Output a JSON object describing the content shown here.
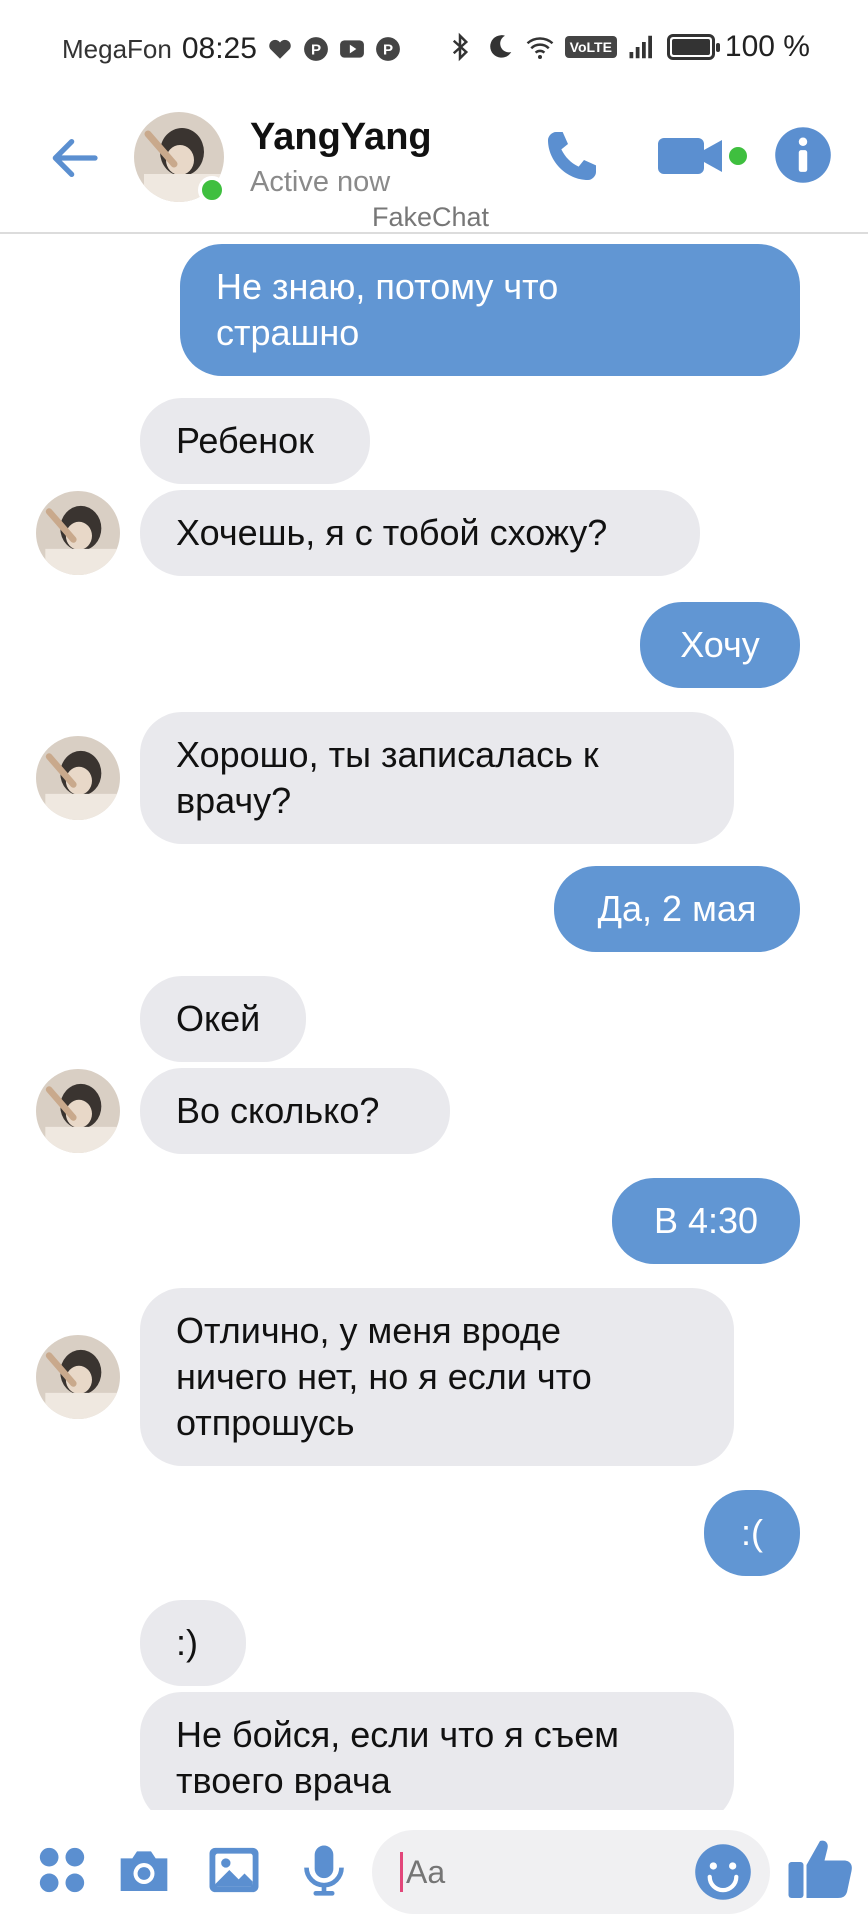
{
  "status_bar": {
    "carrier": "MegaFon",
    "time": "08:25",
    "volte": "VoLTE",
    "battery_text": "100 %",
    "battery_level": 1.0,
    "app_icons": [
      "heart-icon",
      "pinterest-icon",
      "youtube-icon",
      "pinterest-icon"
    ],
    "system_icons": [
      "bluetooth-icon",
      "moon-icon",
      "wifi-icon",
      "volte-icon",
      "signal-icon",
      "battery-icon"
    ]
  },
  "header": {
    "contact_name": "YangYang",
    "status": "Active now",
    "watermark": "FakeChat",
    "accent_color": "#5b8fd0",
    "online_color": "#3fbf3f"
  },
  "messages": [
    {
      "dir": "out",
      "lines": [
        "Не знаю, потому что",
        "страшно"
      ]
    },
    {
      "dir": "in",
      "lines": [
        "Ребенок"
      ],
      "avatar": false
    },
    {
      "dir": "in",
      "lines": [
        "Хочешь, я с тобой схожу?"
      ],
      "avatar": true
    },
    {
      "dir": "out",
      "lines": [
        "Хочу"
      ]
    },
    {
      "dir": "in",
      "lines": [
        "Хорошо, ты записалась к",
        "врачу?"
      ],
      "avatar": true
    },
    {
      "dir": "out",
      "lines": [
        "Да, 2 мая"
      ]
    },
    {
      "dir": "in",
      "lines": [
        "Окей"
      ],
      "avatar": false
    },
    {
      "dir": "in",
      "lines": [
        "Во сколько?"
      ],
      "avatar": true
    },
    {
      "dir": "out",
      "lines": [
        "В 4:30"
      ]
    },
    {
      "dir": "in",
      "lines": [
        "Отлично, у меня вроде",
        "ничего нет, но я если что",
        "отпрошусь"
      ],
      "avatar": true
    },
    {
      "dir": "out",
      "lines": [
        ":("
      ]
    },
    {
      "dir": "in",
      "lines": [
        ":)"
      ],
      "avatar": false
    },
    {
      "dir": "in",
      "lines": [
        "Не бойся, если что я съем",
        "твоего врача"
      ],
      "avatar": false
    }
  ],
  "composer": {
    "placeholder": "Aa"
  },
  "bottom_bar": {
    "icons": [
      "apps-icon",
      "camera-icon",
      "gallery-icon",
      "microphone-icon",
      "emoji-icon",
      "thumbs-up-icon"
    ]
  },
  "colors": {
    "outgoing_bubble": "#6196d3",
    "incoming_bubble": "#e9e9ed"
  }
}
